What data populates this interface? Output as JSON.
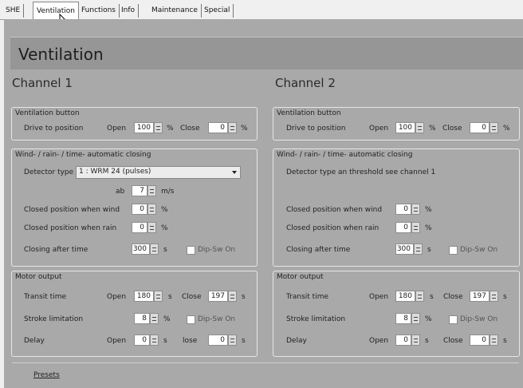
{
  "tabs": [
    "SHE",
    "Ventilation",
    "Functions",
    "Info",
    "Maintenance",
    "Special"
  ],
  "active_tab": "Ventilation",
  "page_title": "Ventilation",
  "channel1": {
    "heading": "Channel 1",
    "vent_button": {
      "title": "Ventilation button",
      "drive_label": "Drive to position",
      "open_label": "Open",
      "open_value": "100",
      "open_unit": "%",
      "close_label": "Close",
      "close_value": "0",
      "close_unit": "%"
    },
    "wind": {
      "title": "Wind- / rain- / time-  automatic closing",
      "detector_label": "Detector type",
      "detector_value": "1 : WRM 24   (pulses)",
      "ab_label": "ab",
      "ab_value": "7",
      "ab_unit": "m/s",
      "closed_wind_label": "Closed position when wind",
      "closed_wind_value": "0",
      "closed_wind_unit": "%",
      "closed_rain_label": "Closed position when rain",
      "closed_rain_value": "0",
      "closed_rain_unit": "%",
      "closing_time_label": "Closing after time",
      "closing_time_value": "300",
      "closing_time_unit": "s",
      "dip_label": "Dip-Sw On"
    },
    "motor": {
      "title": "Motor output",
      "transit_label": "Transit time",
      "transit_open_label": "Open",
      "transit_open_value": "180",
      "transit_open_unit": "s",
      "transit_close_label": "Close",
      "transit_close_value": "197",
      "transit_close_unit": "s",
      "stroke_label": "Stroke limitation",
      "stroke_value": "8",
      "stroke_unit": "%",
      "dip_label": "Dip-Sw On",
      "delay_label": "Delay",
      "delay_open_label": "Open",
      "delay_open_value": "0",
      "delay_open_unit": "s",
      "delay_close_label": "lose",
      "delay_close_value": "0",
      "delay_close_unit": "s"
    }
  },
  "channel2": {
    "heading": "Channel 2",
    "vent_button": {
      "title": "Ventilation button",
      "drive_label": "Drive to position",
      "open_label": "Open",
      "open_value": "100",
      "open_unit": "%",
      "close_label": "Close",
      "close_value": "0",
      "close_unit": "%"
    },
    "wind": {
      "title": "Wind- / rain- / time-  automatic closing",
      "detector_note": "Detector type an threshold  see channel 1",
      "closed_wind_label": "Closed position when wind",
      "closed_wind_value": "0",
      "closed_wind_unit": "%",
      "closed_rain_label": "Closed position when rain",
      "closed_rain_value": "0",
      "closed_rain_unit": "%",
      "closing_time_label": "Closing after time",
      "closing_time_value": "300",
      "closing_time_unit": "s",
      "dip_label": "Dip-Sw On"
    },
    "motor": {
      "title": "Motor output",
      "transit_label": "Transit time",
      "transit_open_label": "Open",
      "transit_open_value": "180",
      "transit_open_unit": "s",
      "transit_close_label": "Close",
      "transit_close_value": "197",
      "transit_close_unit": "s",
      "stroke_label": "Stroke limitation",
      "stroke_value": "8",
      "stroke_unit": "%",
      "dip_label": "Dip-Sw On",
      "delay_label": "Delay",
      "delay_open_label": "Open",
      "delay_open_value": "0",
      "delay_open_unit": "s",
      "delay_close_label": "Close",
      "delay_close_value": "0",
      "delay_close_unit": "s"
    }
  },
  "presets_link": "Presets"
}
